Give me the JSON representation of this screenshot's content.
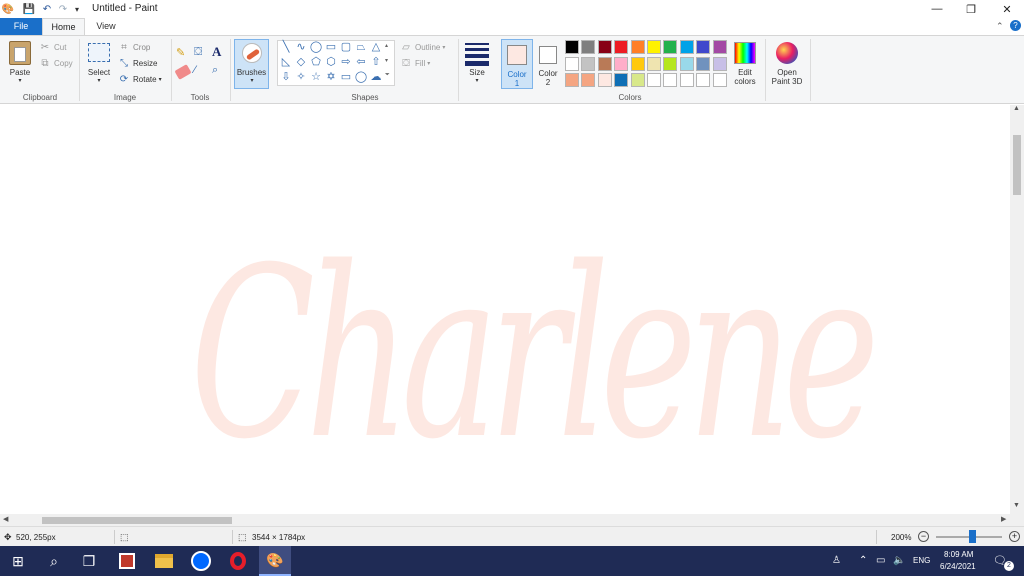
{
  "titlebar": {
    "title": "Untitled - Paint",
    "minimize": "—",
    "maximize": "❐",
    "close": "✕"
  },
  "tabs": {
    "file": "File",
    "home": "Home",
    "view": "View"
  },
  "ribbon": {
    "clipboard": {
      "paste": "Paste",
      "cut": "Cut",
      "copy": "Copy",
      "group": "Clipboard"
    },
    "image": {
      "select": "Select",
      "crop": "Crop",
      "resize": "Resize",
      "rotate": "Rotate",
      "group": "Image"
    },
    "tools": {
      "group": "Tools"
    },
    "brushes": {
      "label": "Brushes"
    },
    "shapes": {
      "outline": "Outline",
      "fill": "Fill",
      "group": "Shapes"
    },
    "size": {
      "label": "Size"
    },
    "color1": {
      "label_a": "Color",
      "label_b": "1"
    },
    "color2": {
      "label_a": "Color",
      "label_b": "2"
    },
    "colors": {
      "group": "Colors",
      "edit_a": "Edit",
      "edit_b": "colors"
    },
    "paint3d": {
      "label_a": "Open",
      "label_b": "Paint 3D"
    }
  },
  "colors": {
    "color1": "#fde8e2",
    "color2": "#ffffff",
    "palette_row1": [
      "#000000",
      "#7f7f7f",
      "#880015",
      "#ed1c24",
      "#ff7f27",
      "#fff200",
      "#22b14c",
      "#00a2e8",
      "#3f48cc",
      "#a349a4"
    ],
    "palette_row2": [
      "#ffffff",
      "#c3c3c3",
      "#b97a57",
      "#ffaec9",
      "#ffc90e",
      "#efe4b0",
      "#b5e61d",
      "#99d9ea",
      "#7092be",
      "#c8bfe7"
    ],
    "palette_row3": [
      "#f4a582",
      "#f4a582",
      "#fde8e2",
      "#0f6fb5",
      "#d8e88a",
      "#ffffff",
      "#ffffff",
      "#ffffff",
      "#ffffff",
      "#ffffff"
    ],
    "canvas_text": "#fde8e2"
  },
  "canvas": {
    "drawing_text": "Charlene"
  },
  "status": {
    "cursor_pos": "520, 255px",
    "image_size": "3544 × 1784px",
    "zoom": "200%"
  },
  "taskbar": {
    "time": "8:09 AM",
    "date": "6/24/2021",
    "lang": "ENG",
    "notifications": "2"
  }
}
